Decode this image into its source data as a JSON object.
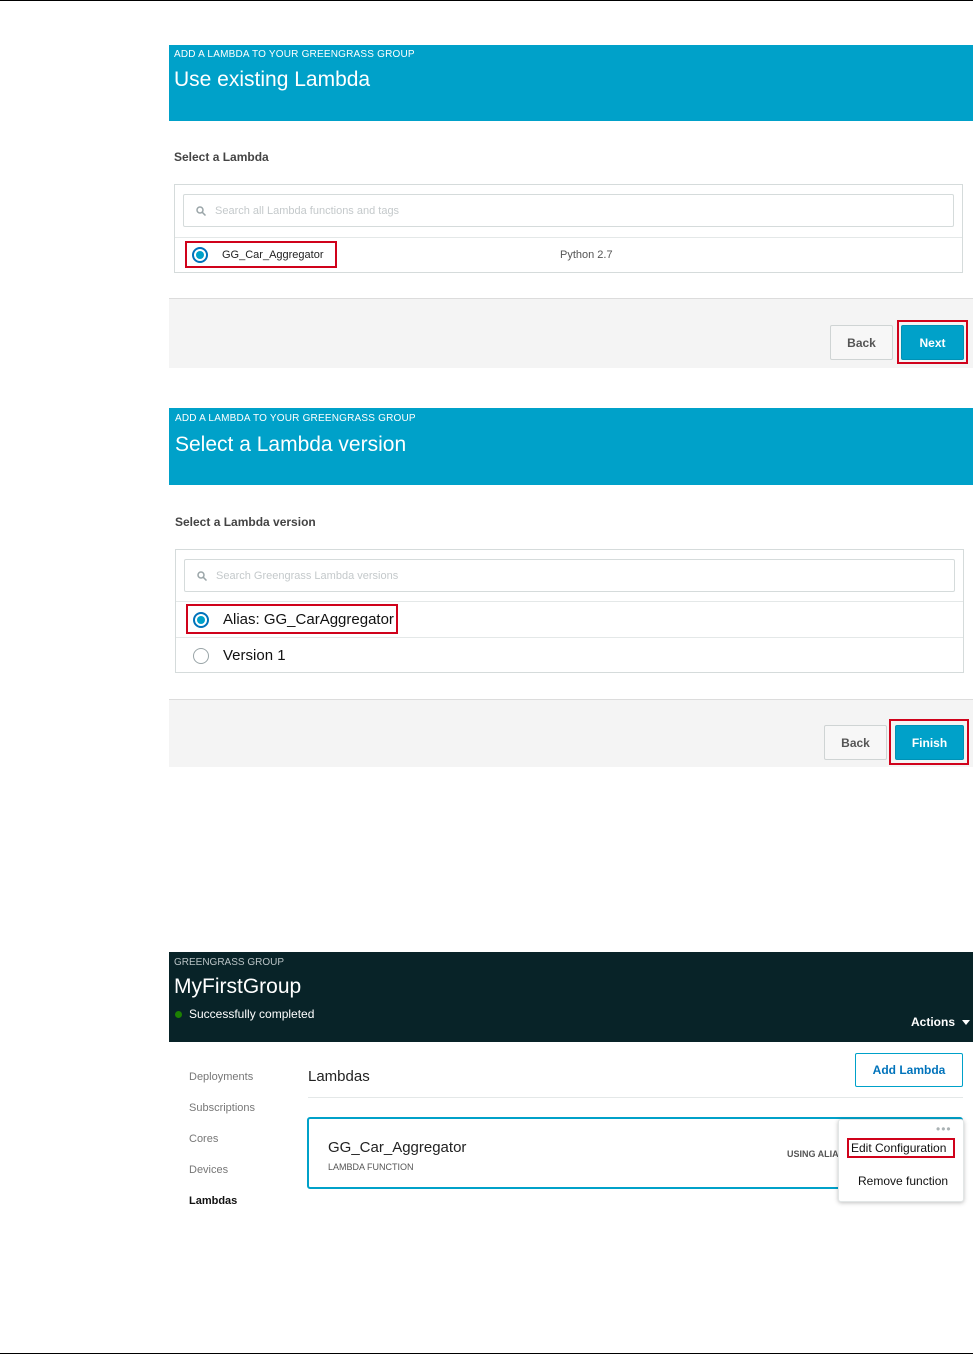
{
  "step1": {
    "kicker": "ADD A LAMBDA TO YOUR GREENGRASS GROUP",
    "title": "Use existing Lambda",
    "section_label": "Select a Lambda",
    "search_placeholder": "Search all Lambda functions and tags",
    "rows": [
      {
        "name": "GG_Car_Aggregator",
        "runtime": "Python 2.7",
        "selected": true
      }
    ],
    "back_label": "Back",
    "next_label": "Next"
  },
  "step2": {
    "kicker": "ADD A LAMBDA TO YOUR GREENGRASS GROUP",
    "title": "Select a Lambda version",
    "section_label": "Select a Lambda version",
    "search_placeholder": "Search Greengrass Lambda versions",
    "rows": [
      {
        "name": "Alias: GG_CarAggregator",
        "selected": true
      },
      {
        "name": "Version 1",
        "selected": false
      }
    ],
    "back_label": "Back",
    "finish_label": "Finish"
  },
  "group": {
    "kicker": "GREENGRASS GROUP",
    "title": "MyFirstGroup",
    "status": "Successfully completed",
    "status_color": "#1d8102",
    "actions_label": "Actions",
    "nav": [
      "Deployments",
      "Subscriptions",
      "Cores",
      "Devices",
      "Lambdas"
    ],
    "active_nav": "Lambdas",
    "section_title": "Lambdas",
    "add_label": "Add Lambda",
    "card": {
      "name": "GG_Car_Aggregator",
      "type": "LAMBDA FUNCTION",
      "using": "USING ALIAS"
    },
    "menu": {
      "edit": "Edit Configuration",
      "remove": "Remove function"
    }
  },
  "colors": {
    "accent": "#00a1c9",
    "highlight": "#d0021b",
    "dark_header": "#082328"
  }
}
